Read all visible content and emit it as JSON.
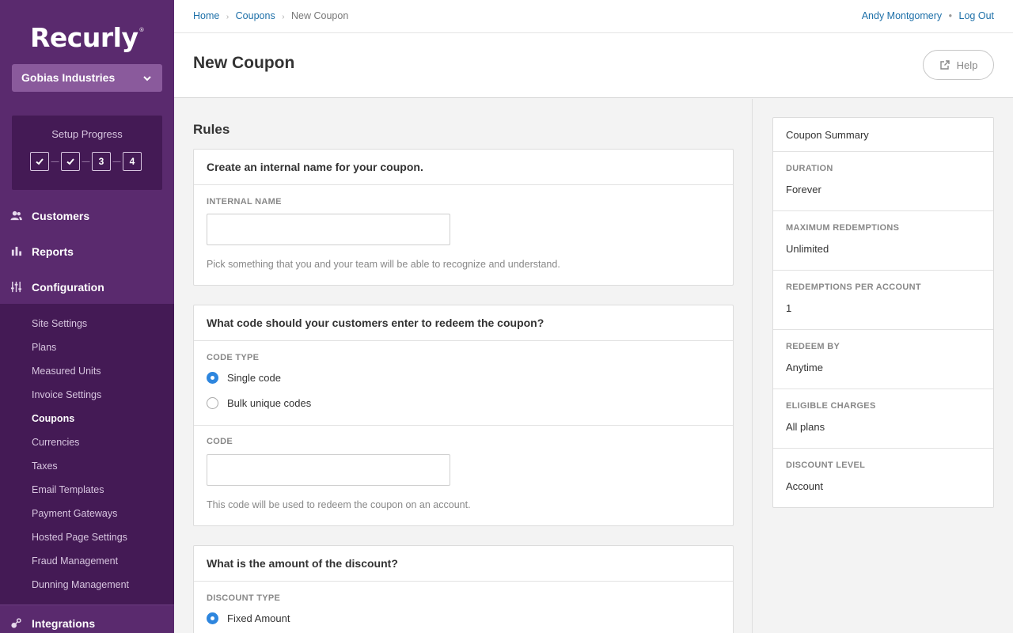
{
  "sidebar": {
    "logo": "Recurly",
    "logo_mark": "®",
    "site_name": "Gobias Industries",
    "setup_title": "Setup Progress",
    "steps": [
      "",
      "",
      "3",
      "4"
    ],
    "nav": {
      "customers": "Customers",
      "reports": "Reports",
      "configuration": "Configuration",
      "integrations": "Integrations"
    },
    "subnav": [
      "Site Settings",
      "Plans",
      "Measured Units",
      "Invoice Settings",
      "Coupons",
      "Currencies",
      "Taxes",
      "Email Templates",
      "Payment Gateways",
      "Hosted Page Settings",
      "Fraud Management",
      "Dunning Management"
    ]
  },
  "topbar": {
    "breadcrumb": [
      "Home",
      "Coupons",
      "New Coupon"
    ],
    "user_name": "Andy Montgomery",
    "logout": "Log Out"
  },
  "header": {
    "title": "New Coupon",
    "help": "Help"
  },
  "main": {
    "section_title": "Rules",
    "card1": {
      "question": "Create an internal name for your coupon.",
      "label": "INTERNAL NAME",
      "value": "",
      "hint": "Pick something that you and your team will be able to recognize and understand."
    },
    "card2": {
      "question": "What code should your customers enter to redeem the coupon?",
      "code_type_label": "CODE TYPE",
      "option_single": "Single code",
      "option_bulk": "Bulk unique codes",
      "code_label": "CODE",
      "code_value": "",
      "hint": "This code will be used to redeem the coupon on an account."
    },
    "card3": {
      "question": "What is the amount of the discount?",
      "discount_type_label": "DISCOUNT TYPE",
      "option_fixed": "Fixed Amount"
    }
  },
  "summary": {
    "title": "Coupon Summary",
    "items": [
      {
        "key": "DURATION",
        "value": "Forever"
      },
      {
        "key": "MAXIMUM REDEMPTIONS",
        "value": "Unlimited"
      },
      {
        "key": "REDEMPTIONS PER ACCOUNT",
        "value": "1"
      },
      {
        "key": "REDEEM BY",
        "value": "Anytime"
      },
      {
        "key": "ELIGIBLE CHARGES",
        "value": "All plans"
      },
      {
        "key": "DISCOUNT LEVEL",
        "value": "Account"
      }
    ]
  },
  "colors": {
    "sidebar": "#5a2a6e",
    "sidebar_dark": "#441a55",
    "accent": "#2e86de",
    "link": "#1c6fa8"
  }
}
